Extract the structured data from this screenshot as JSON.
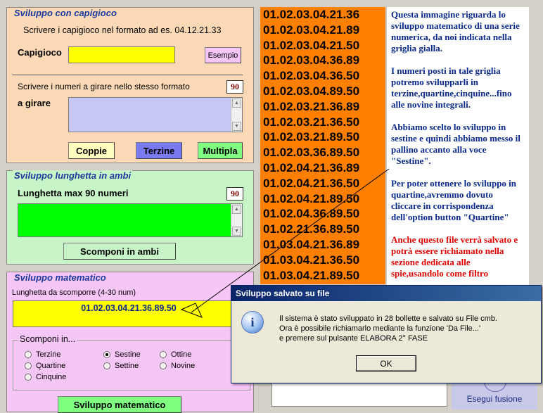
{
  "capigioco_panel": {
    "title": "Sviluppo con capigioco",
    "instruction": "Scrivere i capigioco nel formato ad es. 04.12.21.33",
    "capigioco_label": "Capigioco",
    "capigioco_value": "",
    "esempio_button": "Esempio",
    "numbers_instruction": "Scrivere i numeri a girare nello stesso formato",
    "count": "90",
    "a_girare_label": "a girare",
    "a_girare_value": "",
    "coppie_button": "Coppie",
    "terzine_button": "Terzine",
    "multipla_button": "Multipla"
  },
  "lunghetta_panel": {
    "title": "Sviluppo lunghetta in ambi",
    "label": "Lunghetta max 90 numeri",
    "count": "90",
    "value": "",
    "scomponi_button": "Scomponi in ambi"
  },
  "matematico_panel": {
    "title": "Sviluppo matematico",
    "length_label": "Lunghetta da scomporre (4-30 num)",
    "value": "01.02.03.04.21.36.89.50",
    "group_label": "Scomponi in...",
    "options": [
      "Terzine",
      "Sestine",
      "Ottine",
      "Quartine",
      "Settine",
      "Novine",
      "Cinquine"
    ],
    "selected": "Sestine",
    "button": "Sviluppo matematico"
  },
  "results": [
    "01.02.03.04.21.36",
    "01.02.03.04.21.89",
    "01.02.03.04.21.50",
    "01.02.03.04.36.89",
    "01.02.03.04.36.50",
    "01.02.03.04.89.50",
    "01.02.03.21.36.89",
    "01.02.03.21.36.50",
    "01.02.03.21.89.50",
    "01.02.03.36.89.50",
    "01.02.04.21.36.89",
    "01.02.04.21.36.50",
    "01.02.04.21.89.50",
    "01.02.04.36.89.50",
    "01.02.21.36.89.50",
    "01.03.04.21.36.89",
    "01.03.04.21.36.50",
    "01.03.04.21.89.50"
  ],
  "info": {
    "p1": "Questa immagine riguarda lo sviluppo matematico di una serie numerica, da noi indicata nella griglia gialla.",
    "p2": "I numeri posti in tale griglia potremo svilupparli in terzine,quartine,cinquine...fino alle novine integrali.",
    "p3": "Abbiamo scelto lo sviluppo in sestine e quindi abbiamo messo il pallino accanto alla voce \"Sestine\".",
    "p4": "Per poter ottenere lo sviluppo in quartine,avremmo dovuto cliccare in corrispondenza dell'option button \"Quartine\"",
    "p5": "Anche questo file verrà salvato e potrà essere richiamato nella sezione dedicata alle spie,usandolo come filtro"
  },
  "dialog": {
    "title": "Sviluppo salvato su file",
    "line1": "Il sistema è stato sviluppato in 28 bollette e salvato su File cmb.",
    "line2": "Ora è possibile richiamarlo mediante la funzione 'Da File...'",
    "line3": "e premere sul pulsante ELABORA 2° FASE",
    "ok_button": "OK"
  },
  "fusion_button": "Esegui fusione",
  "colors": {
    "capigioco_bg": "#fbd9b6",
    "lunghetta_bg": "#c7f5c7",
    "matematico_bg": "#f6c6f6",
    "yellow_input": "#ffff00",
    "lavender_input": "#c8c8f4",
    "green_input": "#00ff00",
    "results_bg": "#ff8000"
  }
}
